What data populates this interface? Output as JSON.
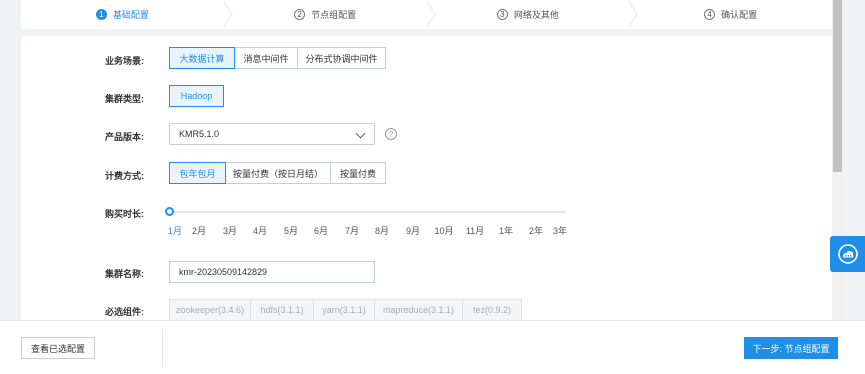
{
  "steps": [
    {
      "num": "1",
      "label": "基础配置",
      "active": true
    },
    {
      "num": "2",
      "label": "节点组配置",
      "active": false
    },
    {
      "num": "3",
      "label": "网络及其他",
      "active": false
    },
    {
      "num": "4",
      "label": "确认配置",
      "active": false
    }
  ],
  "form": {
    "scenario": {
      "label": "业务场景:",
      "options": [
        "大数据计算",
        "消息中间件",
        "分布式协调中间件"
      ],
      "selected": "大数据计算"
    },
    "cluster_type": {
      "label": "集群类型:",
      "options": [
        "Hadoop"
      ],
      "selected": "Hadoop"
    },
    "version": {
      "label": "产品版本:",
      "value": "KMR5.1.0",
      "help": "?"
    },
    "billing": {
      "label": "计费方式:",
      "options": [
        "包年包月",
        "按量付费（按日月结）",
        "按量付费"
      ],
      "selected": "包年包月"
    },
    "duration": {
      "label": "购买时长:",
      "ticks": [
        "1月",
        "2月",
        "3月",
        "4月",
        "5月",
        "6月",
        "7月",
        "8月",
        "9月",
        "10月",
        "11月",
        "1年",
        "2年",
        "3年"
      ],
      "selected": "1月"
    },
    "cluster_name": {
      "label": "集群名称:",
      "value": "kmr-20230509142829"
    },
    "components": {
      "label": "必选组件:",
      "options": [
        "zookeeper(3.4.6)",
        "hdfs(3.1.1)",
        "yarn(3.1.1)",
        "mapreduce(3.1.1)",
        "tez(0.9.2)"
      ]
    }
  },
  "footer": {
    "view_config": "查看已选配置",
    "next": "下一步: 节点组配置"
  },
  "colors": {
    "accent": "#1e8ee8"
  }
}
